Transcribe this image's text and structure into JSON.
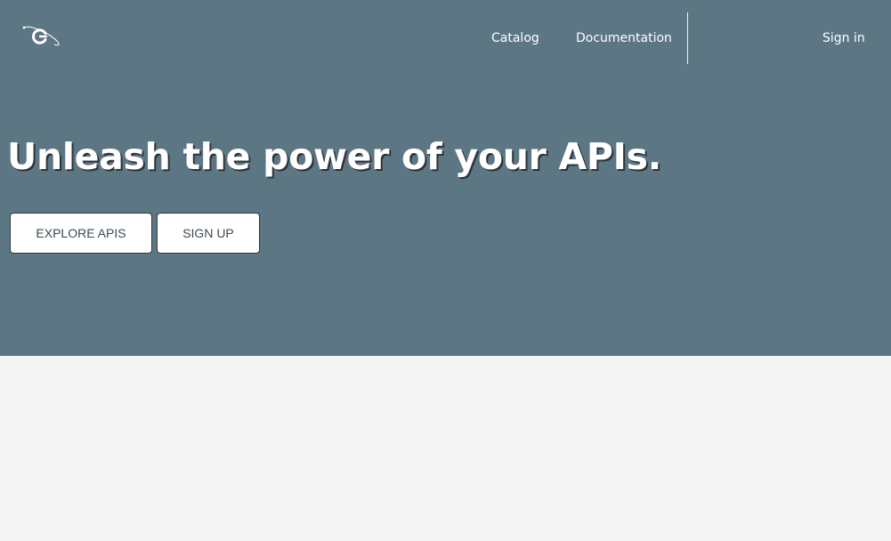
{
  "header": {
    "logo_icon": "orbit-c-logo-icon",
    "nav": {
      "catalog": "Catalog",
      "documentation": "Documentation",
      "sign_in": "Sign in"
    }
  },
  "hero": {
    "title": "Unleash the power of your APIs.",
    "buttons": {
      "explore": "EXPLORE APIS",
      "signup": "SIGN UP"
    }
  },
  "colors": {
    "hero_background": "#5d7684",
    "page_background": "#f4f4f4",
    "button_background": "#ffffff",
    "button_text": "#3a4a55"
  }
}
